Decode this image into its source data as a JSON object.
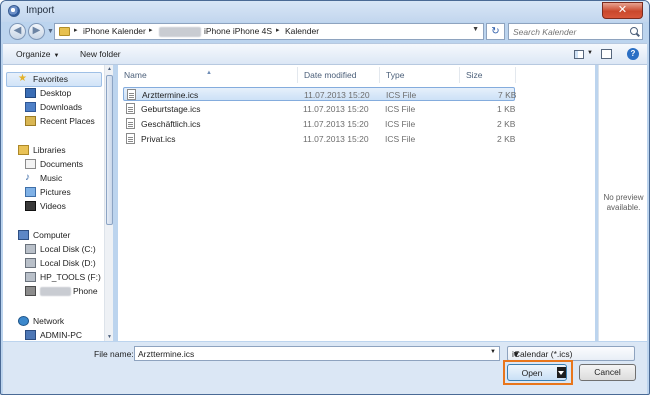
{
  "window": {
    "title": "Import",
    "close_glyph": "✕"
  },
  "navigation": {
    "back_glyph": "◀",
    "forward_glyph": "▶",
    "refresh_glyph": "↻"
  },
  "address": {
    "crumbs": [
      "iPhone Kalender",
      "iPhone iPhone 4S",
      "Kalender"
    ],
    "separator": "▸"
  },
  "search": {
    "placeholder": "Search Kalender",
    "value": ""
  },
  "toolbar": {
    "organize_label": "Organize",
    "new_folder_label": "New folder",
    "help_glyph": "?"
  },
  "sidebar": {
    "favorites_label": "Favorites",
    "favorites": [
      "Desktop",
      "Downloads",
      "Recent Places"
    ],
    "libraries_label": "Libraries",
    "libraries": [
      "Documents",
      "Music",
      "Pictures",
      "Videos"
    ],
    "computer_label": "Computer",
    "computer": [
      "Local Disk (C:)",
      "Local Disk (D:)",
      "HP_TOOLS (F:)",
      "Phone"
    ],
    "network_label": "Network",
    "network": [
      "ADMIN-PC"
    ]
  },
  "filelist": {
    "columns": {
      "name": "Name",
      "date": "Date modified",
      "type": "Type",
      "size": "Size"
    },
    "rows": [
      {
        "name": "Arzttermine.ics",
        "date": "11.07.2013 15:20",
        "type": "ICS File",
        "size": "7 KB"
      },
      {
        "name": "Geburtstage.ics",
        "date": "11.07.2013 15:20",
        "type": "ICS File",
        "size": "1 KB"
      },
      {
        "name": "Geschäftlich.ics",
        "date": "11.07.2013 15:20",
        "type": "ICS File",
        "size": "2 KB"
      },
      {
        "name": "Privat.ics",
        "date": "11.07.2013 15:20",
        "type": "ICS File",
        "size": "2 KB"
      }
    ]
  },
  "preview": {
    "line1": "No preview",
    "line2": "available."
  },
  "footer": {
    "file_name_label": "File name:",
    "file_name_value": "Arzttermine.ics",
    "file_type": "iCalendar (*.ics)",
    "open_label": "Open",
    "cancel_label": "Cancel",
    "highlight_color": "#e8761c"
  }
}
